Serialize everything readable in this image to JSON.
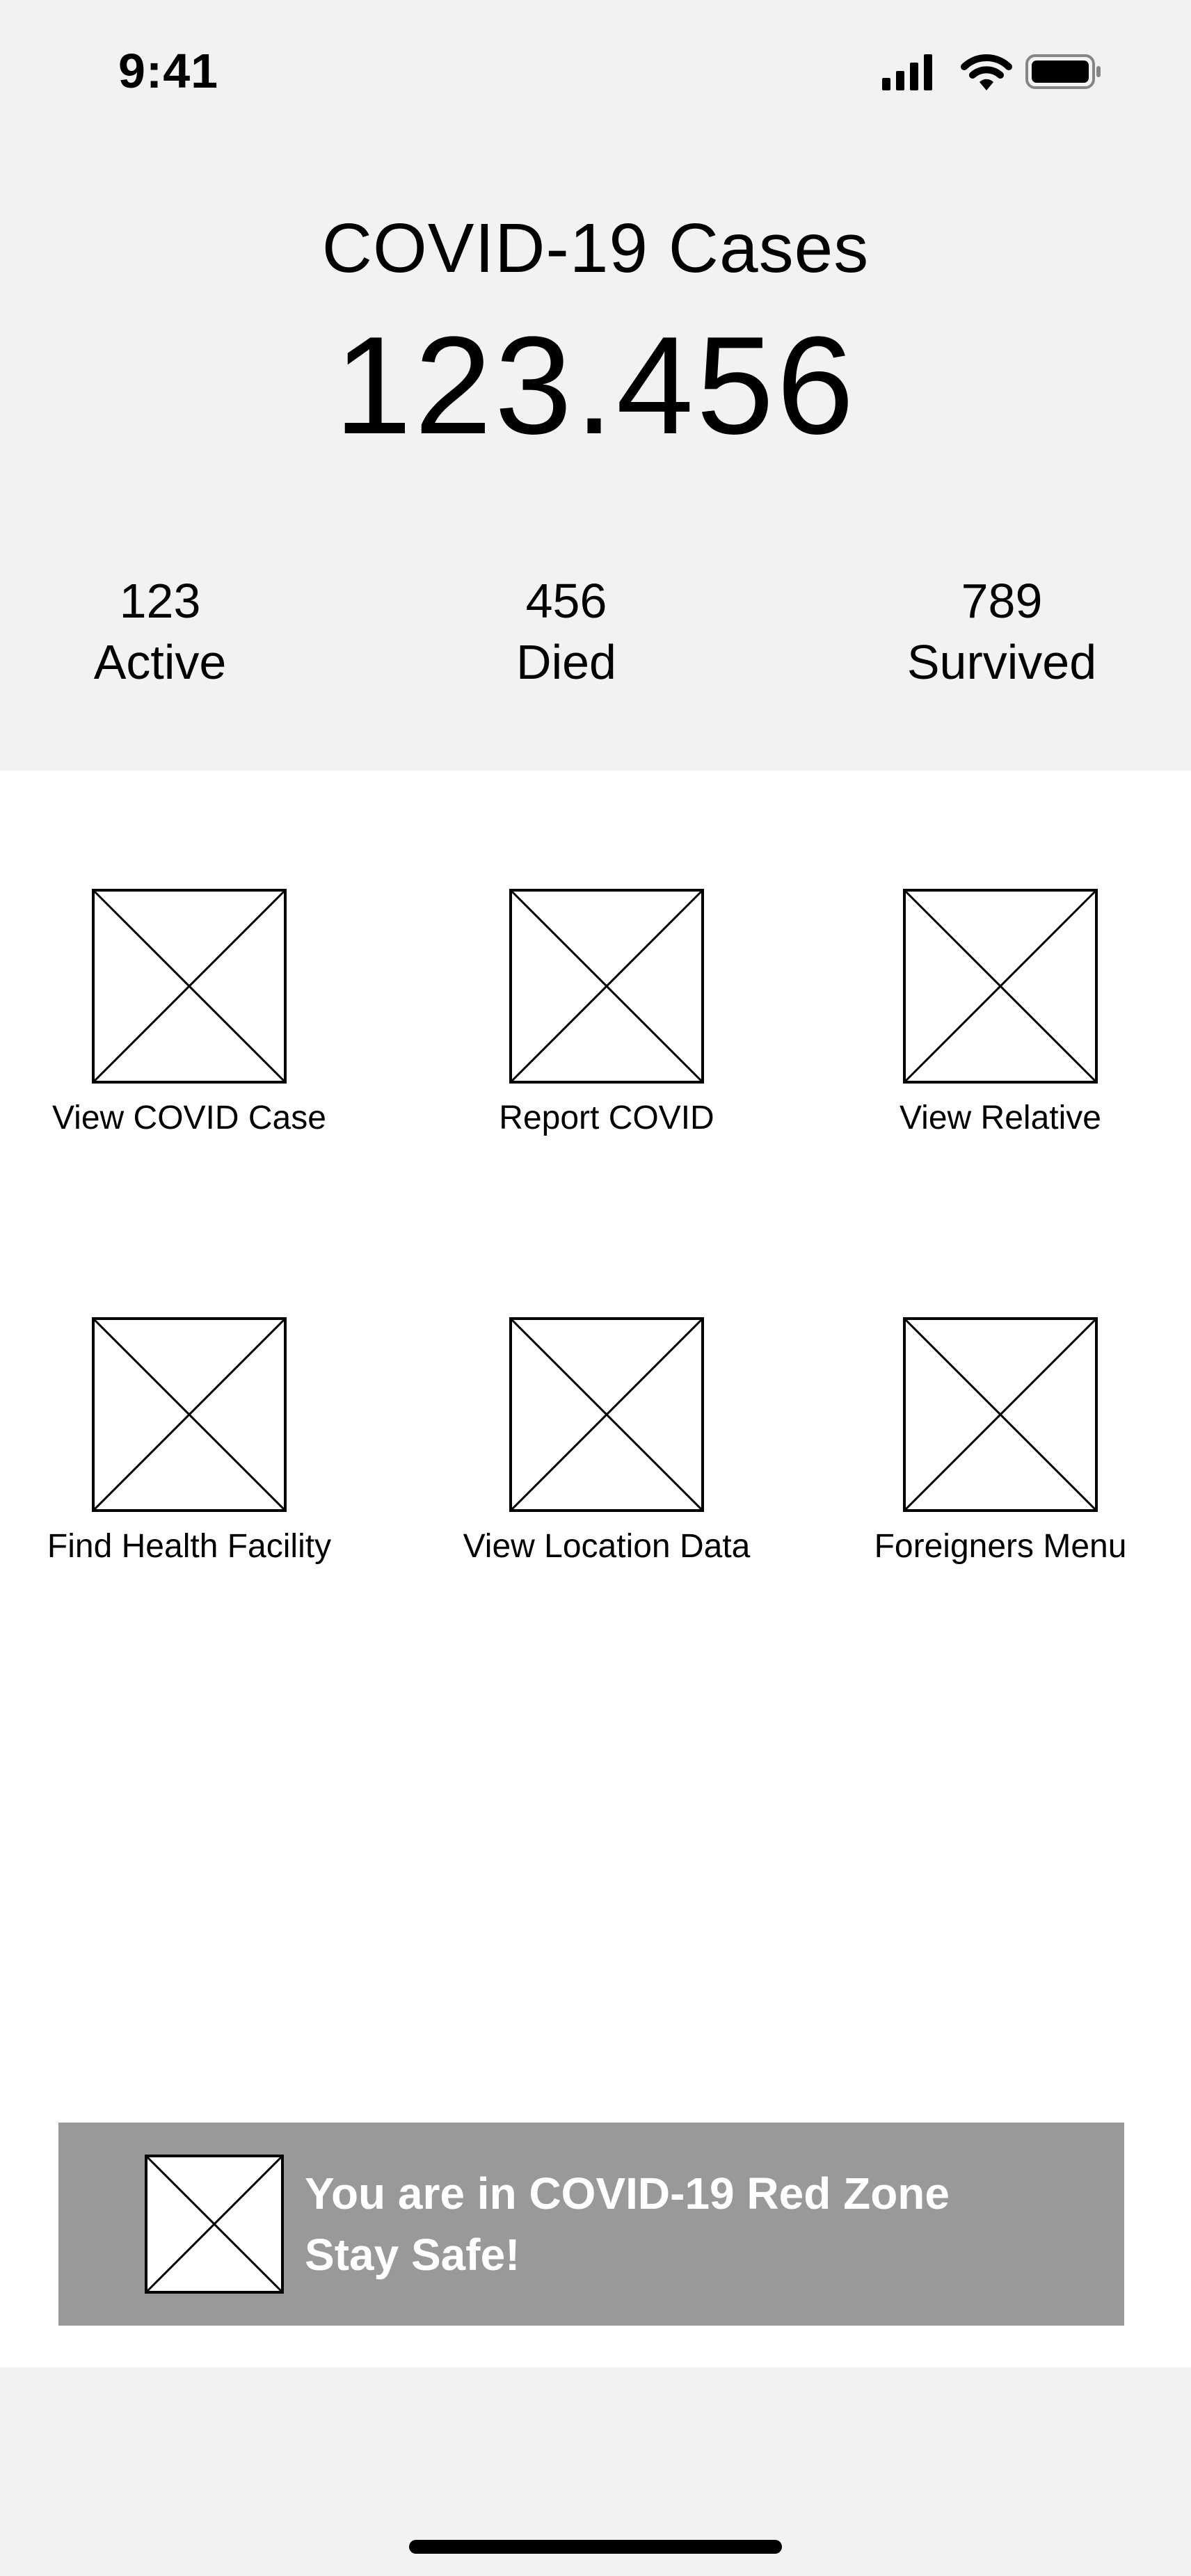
{
  "status_bar": {
    "time": "9:41",
    "icons": [
      "cellular-signal-icon",
      "wifi-icon",
      "battery-icon"
    ]
  },
  "summary": {
    "title": "COVID-19 Cases",
    "total": "123.456",
    "stats": [
      {
        "value": "123",
        "label": "Active"
      },
      {
        "value": "456",
        "label": "Died"
      },
      {
        "value": "789",
        "label": "Survived"
      }
    ]
  },
  "menu": {
    "items": [
      {
        "label": "View COVID Case",
        "icon": "image-placeholder-icon"
      },
      {
        "label": "Report COVID",
        "icon": "image-placeholder-icon"
      },
      {
        "label": "View Relative",
        "icon": "image-placeholder-icon"
      },
      {
        "label": "Find Health Facility",
        "icon": "image-placeholder-icon"
      },
      {
        "label": "View Location Data",
        "icon": "image-placeholder-icon"
      },
      {
        "label": "Foreigners Menu",
        "icon": "image-placeholder-icon"
      }
    ]
  },
  "alert": {
    "line1": "You are in COVID-19 Red Zone",
    "line2": "Stay Safe!",
    "icon": "image-placeholder-icon"
  },
  "colors": {
    "header_bg": "#f2f2f2",
    "banner_bg": "#999999",
    "banner_text": "#ffffff"
  }
}
